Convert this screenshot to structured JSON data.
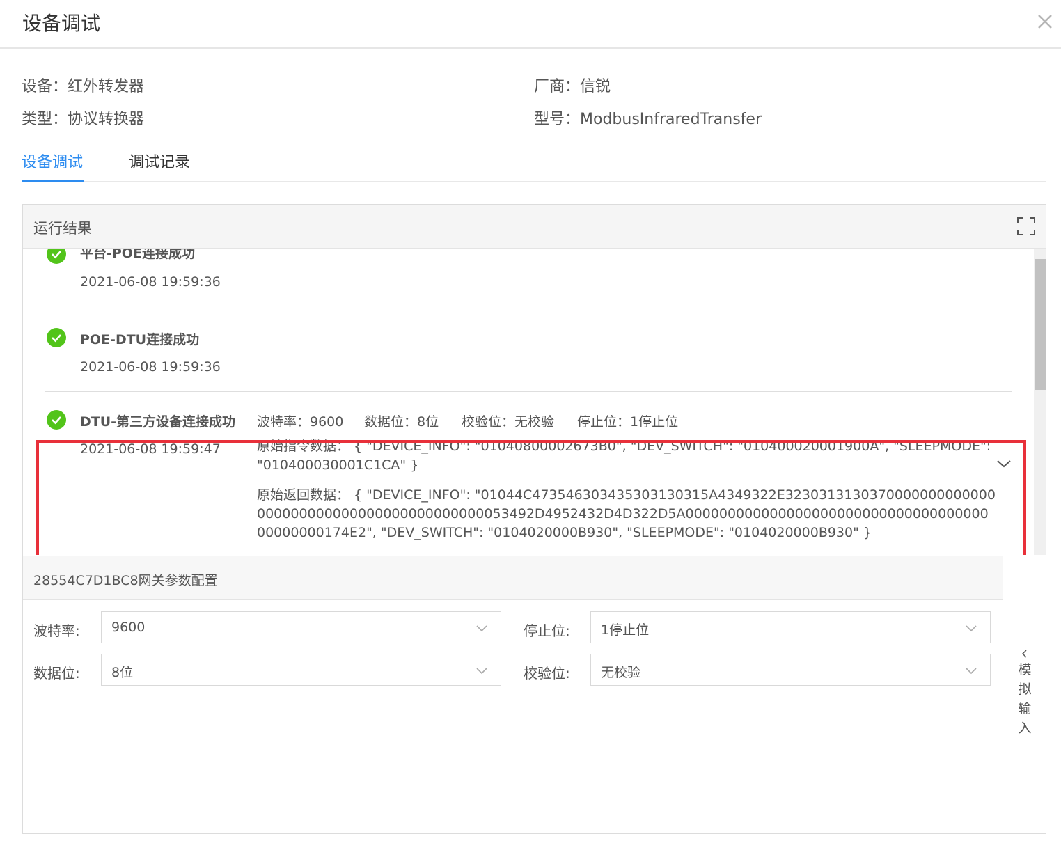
{
  "dialog": {
    "title": "设备调试",
    "close_icon": "close-icon"
  },
  "device_info": {
    "device": "设备：红外转发器",
    "vendor": "厂商：信锐",
    "type": "类型：协议转换器",
    "model": "型号：ModbusInfraredTransfer"
  },
  "tabs": [
    {
      "label": "设备调试",
      "active": true
    },
    {
      "label": "调试记录",
      "active": false
    }
  ],
  "results_panel": {
    "title": "运行结果",
    "items": [
      {
        "title": "平台-POE连接成功",
        "time": "2021-06-08 19:59:36",
        "status": "success"
      },
      {
        "title": "POE-DTU连接成功",
        "time": "2021-06-08 19:59:36",
        "status": "success"
      },
      {
        "title": "DTU-第三方设备连接成功",
        "time": "2021-06-08 19:59:47",
        "status": "success",
        "params": {
          "baud": "波特率：9600",
          "data_bits": "数据位：8位",
          "parity": "校验位：无校验",
          "stop_bits": "停止位：1停止位"
        },
        "raw_command": "原始指令数据：  { \"DEVICE_INFO\": \"01040800002673B0\", \"DEV_SWITCH\": \"010400020001900A\", \"SLEEPMODE\": \"010400030001C1CA\" }",
        "raw_response": "原始返回数据：  { \"DEVICE_INFO\": \"01044C473546303435303130315A4349322E3230313130370000000000000000000000000000000000000000053492D4952432D4D322D5A00000000000000000000000000000000000000000000174E2\", \"DEV_SWITCH\": \"0104020000B930\", \"SLEEPMODE\": \"0104020000B930\" }"
      }
    ]
  },
  "config": {
    "title": "28554C7D1BC8网关参数配置",
    "baud_label": "波特率:",
    "baud_value": "9600",
    "stop_label": "停止位:",
    "stop_value": "1停止位",
    "data_label": "数据位:",
    "data_value": "8位",
    "parity_label": "校验位:",
    "parity_value": "无校验"
  },
  "side_panel": {
    "label": "模拟输入",
    "chars": [
      "模",
      "拟",
      "输",
      "入"
    ]
  },
  "colors": {
    "accent": "#2d8cf0",
    "success": "#52c41a",
    "highlight": "#e8303a"
  }
}
